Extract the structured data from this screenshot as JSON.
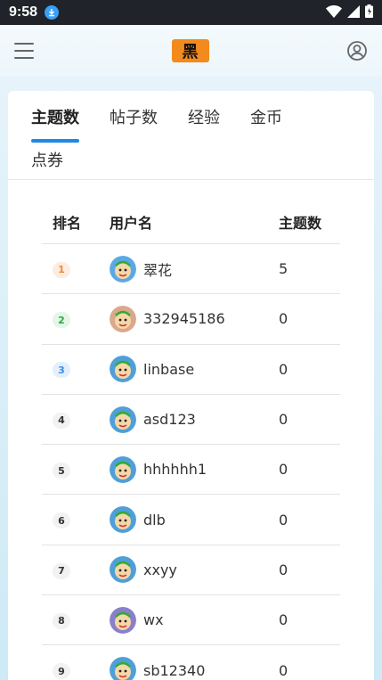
{
  "status_bar": {
    "time": "9:58",
    "icons": [
      "download-icon",
      "wifi-icon",
      "signal-icon",
      "battery-icon"
    ]
  },
  "header": {
    "logo_text": "黑",
    "logo_color": "#f28a1e",
    "icons": [
      "menu-icon",
      "user-profile-icon"
    ]
  },
  "tabs": [
    {
      "label": "主题数",
      "active": true
    },
    {
      "label": "帖子数",
      "active": false
    },
    {
      "label": "经验",
      "active": false
    },
    {
      "label": "金币",
      "active": false
    },
    {
      "label": "点券",
      "active": false
    }
  ],
  "accent_color": "#1e88e5",
  "table": {
    "headers": {
      "rank": "排名",
      "user": "用户名",
      "count": "主题数"
    },
    "rows": [
      {
        "rank": "1",
        "user": "翠花",
        "count": "5",
        "rank_color": "#f08a3c",
        "rank_bg": "#fdece0",
        "avatar_bg": "#5ba8e6"
      },
      {
        "rank": "2",
        "user": "332945186",
        "count": "0",
        "rank_color": "#2ea84a",
        "rank_bg": "#e3f6e7",
        "avatar_bg": "#d9a98a"
      },
      {
        "rank": "3",
        "user": "linbase",
        "count": "0",
        "rank_color": "#3a8ee6",
        "rank_bg": "#e3effc",
        "avatar_bg": "#4f9fd8"
      },
      {
        "rank": "4",
        "user": "asd123",
        "count": "0",
        "rank_color": "#333333",
        "rank_bg": "#f2f2f2",
        "avatar_bg": "#4f9fd8"
      },
      {
        "rank": "5",
        "user": "hhhhhh1",
        "count": "0",
        "rank_color": "#333333",
        "rank_bg": "#f2f2f2",
        "avatar_bg": "#4f9fd8"
      },
      {
        "rank": "6",
        "user": "dlb",
        "count": "0",
        "rank_color": "#333333",
        "rank_bg": "#f2f2f2",
        "avatar_bg": "#4f9fd8"
      },
      {
        "rank": "7",
        "user": "xxyy",
        "count": "0",
        "rank_color": "#333333",
        "rank_bg": "#f2f2f2",
        "avatar_bg": "#4f9fd8"
      },
      {
        "rank": "8",
        "user": "wx",
        "count": "0",
        "rank_color": "#333333",
        "rank_bg": "#f2f2f2",
        "avatar_bg": "#8a7fc9"
      },
      {
        "rank": "9",
        "user": "sb12340",
        "count": "0",
        "rank_color": "#333333",
        "rank_bg": "#f2f2f2",
        "avatar_bg": "#4f9fd8"
      }
    ]
  }
}
